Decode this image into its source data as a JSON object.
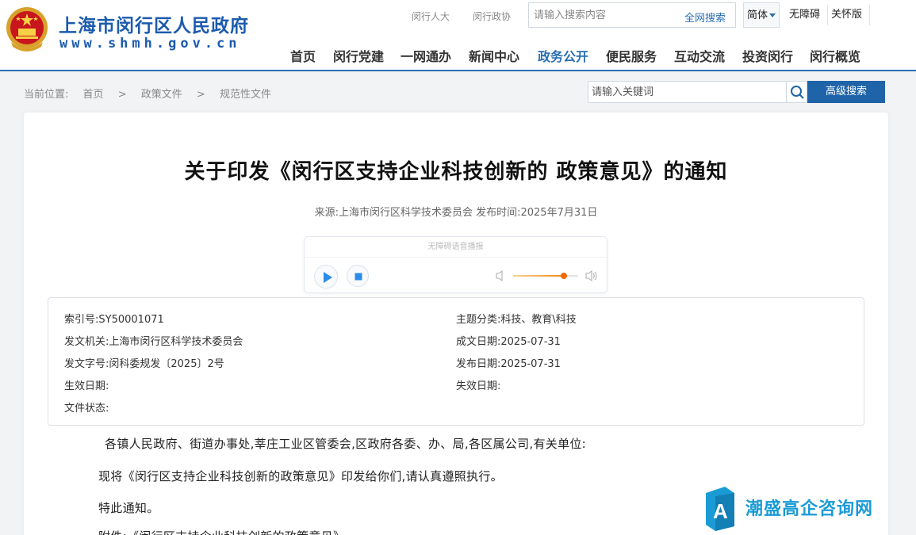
{
  "header": {
    "site_name": "上海市闵行区人民政府",
    "site_domain": "www.shmh.gov.cn",
    "top_links": [
      "闵行人大",
      "闵行政协"
    ],
    "search": {
      "placeholder": "请输入搜索内容",
      "button": "全网搜索"
    },
    "versions": [
      "简体",
      "无障碍",
      "关怀版"
    ],
    "nav": [
      "首页",
      "闵行党建",
      "一网通办",
      "新闻中心",
      "政务公开",
      "便民服务",
      "互动交流",
      "投资闵行",
      "闵行概览"
    ],
    "active_nav": "政务公开"
  },
  "breadcrumb": {
    "label": "当前位置:",
    "items": [
      "首页",
      ">",
      "政策文件",
      ">",
      "规范性文件"
    ]
  },
  "search2": {
    "placeholder": "请输入关键词",
    "button": "高级搜索"
  },
  "doc": {
    "title": "关于印发《闵行区支持企业科技创新的 政策意见》的通知",
    "meta": "来源:上海市闵行区科学技术委员会  发布时间:2025年7月31日"
  },
  "player": {
    "title": "无障碍语音播报",
    "volume_fraction": 0.78
  },
  "info": {
    "left": [
      {
        "key": "索引号:",
        "value": "SY50001071"
      },
      {
        "key": "发文机关:",
        "value": "上海市闵行区科学技术委员会"
      },
      {
        "key": "发文字号:",
        "value": "闵科委规发〔2025〕2号"
      },
      {
        "key": "生效日期:",
        "value": ""
      },
      {
        "key": "文件状态:",
        "value": ""
      }
    ],
    "right": [
      {
        "key": "主题分类:",
        "value": "科技、教育\\科技"
      },
      {
        "key": "成文日期:",
        "value": "2025-07-31"
      },
      {
        "key": "发布日期:",
        "value": "2025-07-31"
      },
      {
        "key": "失效日期:",
        "value": ""
      }
    ]
  },
  "body": {
    "addressee": "各镇人民政府、街道办事处,莘庄工业区管委会,区政府各委、办、局,各区属公司,有关单位:",
    "para1": "现将《闵行区支持企业科技创新的政策意见》印发给你们,请认真遵照执行。",
    "para2": "特此通知。",
    "attachment": "附件:《闵行区支持企业科技创新的政策意见》"
  },
  "watermark": {
    "text": "潮盛高企咨询网"
  },
  "colors": {
    "brand": "#1c5bae",
    "nav_active": "#2a6fb4",
    "button": "#1f64a9",
    "volume": "#f06a0a"
  }
}
